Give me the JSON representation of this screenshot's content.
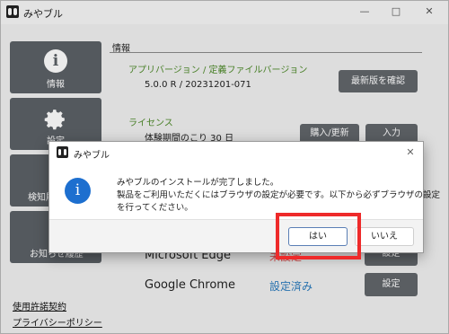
{
  "window": {
    "title": "みやブル"
  },
  "sidebar": {
    "items": [
      {
        "label": "情報",
        "icon": "info-icon"
      },
      {
        "label": "設定",
        "icon": "gear-icon"
      },
      {
        "label": "検知履歴",
        "icon": ""
      },
      {
        "label": "お知らせ履歴",
        "icon": ""
      }
    ],
    "links": [
      "使用許諾契約",
      "プライバシーポリシー"
    ]
  },
  "main": {
    "section_title": "情報",
    "app_version_label": "アプリバージョン / 定義ファイルバージョン",
    "app_version_value": "5.0.0 R / 20231201-071",
    "check_latest_button": "最新版を確認",
    "license_label": "ライセンス",
    "license_value": "体験期間のこり 30 日",
    "purchase_button": "購入/更新",
    "input_button": "入力",
    "browsers": [
      {
        "name": "Microsoft Edge",
        "status": "未設定",
        "button": "設定"
      },
      {
        "name": "Google Chrome",
        "status": "設定済み",
        "button": "設定"
      }
    ]
  },
  "dialog": {
    "title": "みやブル",
    "line1": "みやブルのインストールが完了しました。",
    "line2": "製品をご利用いただくにはブラウザの設定が必要です。以下から必ずブラウザの設定",
    "line3": "を行ってください。",
    "yes_button": "はい",
    "no_button": "いいえ"
  },
  "colors": {
    "accent_green": "#4e8a2a",
    "accent_blue": "#2b7bbd",
    "sidebar": "#5c6166",
    "highlight": "#ee2a2a"
  }
}
